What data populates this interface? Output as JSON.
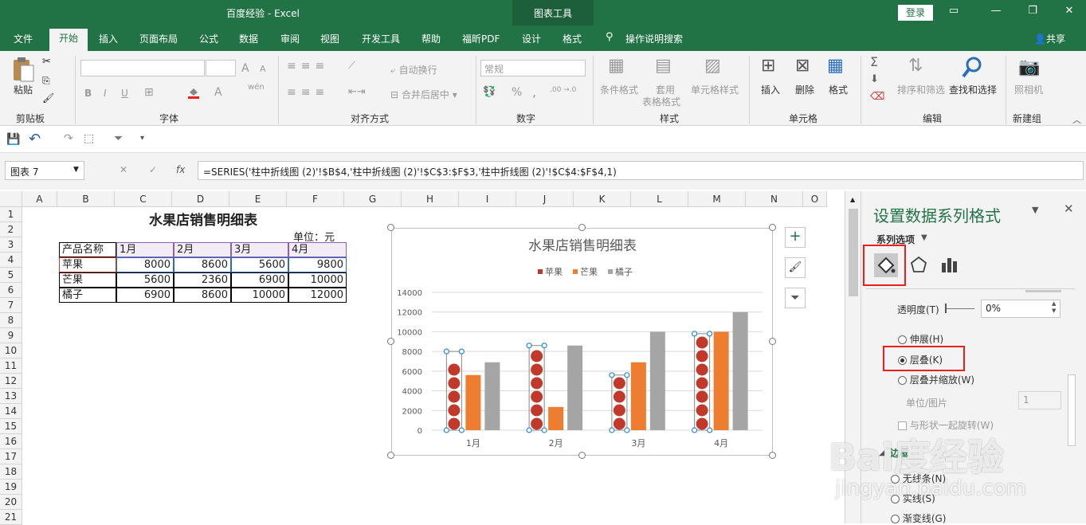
{
  "titlebar": {
    "title": "百度经验  -  Excel",
    "chart_tools": "图表工具",
    "login": "登录",
    "minimize": "—",
    "restore": "❐",
    "close": "✕"
  },
  "menu": {
    "tabs": [
      "文件",
      "开始",
      "插入",
      "页面布局",
      "公式",
      "数据",
      "审阅",
      "视图",
      "开发工具",
      "帮助",
      "福昕PDF",
      "设计",
      "格式"
    ],
    "search": "操作说明搜索",
    "share": "共享"
  },
  "ribbon": {
    "clipboard": {
      "paste": "粘贴",
      "label": "剪贴板"
    },
    "font": {
      "label": "字体",
      "bold": "B",
      "italic": "I",
      "underline": "U",
      "grow": "A",
      "shrink": "A",
      "wen": "wén"
    },
    "align": {
      "label": "对齐方式",
      "wrap": "自动换行",
      "merge": "合并后居中"
    },
    "number": {
      "label": "数字",
      "format": "常规",
      "percent": "%",
      "comma": ","
    },
    "styles": {
      "label": "样式",
      "cond": "条件格式",
      "table1": "套用",
      "table2": "表格格式",
      "cell": "单元格样式"
    },
    "cells": {
      "label": "单元格",
      "insert": "插入",
      "delete": "删除",
      "format": "格式"
    },
    "edit": {
      "label": "编辑",
      "sort": "排序和筛选",
      "find": "查找和选择"
    },
    "newgroup": {
      "label": "新建组",
      "camera": "照相机"
    }
  },
  "formula_bar": {
    "name_box": "图表 7",
    "fx": "fx",
    "cancel": "✕",
    "enter": "✓",
    "formula": "=SERIES('柱中折线图 (2)'!$B$4,'柱中折线图 (2)'!$C$3:$F$3,'柱中折线图 (2)'!$C$4:$F$4,1)"
  },
  "sheet": {
    "columns": [
      "A",
      "B",
      "C",
      "D",
      "E",
      "F",
      "G",
      "H",
      "I",
      "J",
      "K",
      "L",
      "M",
      "N",
      "O"
    ],
    "rows": [
      "1",
      "2",
      "3",
      "4",
      "5",
      "6",
      "7",
      "8",
      "9",
      "10",
      "11",
      "12",
      "13",
      "14",
      "15",
      "16",
      "17",
      "18",
      "19",
      "20",
      "21"
    ],
    "title": "水果店销售明细表",
    "unit": "单位：元",
    "header": [
      "产品名称",
      "1月",
      "2月",
      "3月",
      "4月"
    ],
    "data": [
      [
        "苹果",
        "8000",
        "8600",
        "5600",
        "9800"
      ],
      [
        "芒果",
        "5600",
        "2360",
        "6900",
        "10000"
      ],
      [
        "橘子",
        "6900",
        "8600",
        "10000",
        "12000"
      ]
    ]
  },
  "chart_data": {
    "type": "bar",
    "title": "水果店销售明细表",
    "categories": [
      "1月",
      "2月",
      "3月",
      "4月"
    ],
    "series": [
      {
        "name": "苹果",
        "values": [
          8000,
          8600,
          5600,
          9800
        ],
        "color": "#c0392b"
      },
      {
        "name": "芒果",
        "values": [
          5600,
          2360,
          6900,
          10000
        ],
        "color": "#ed7d31"
      },
      {
        "name": "橘子",
        "values": [
          6900,
          8600,
          10000,
          12000
        ],
        "color": "#a5a5a5"
      }
    ],
    "ylim": [
      0,
      14000
    ],
    "yticks": [
      "0",
      "2000",
      "4000",
      "6000",
      "8000",
      "10000",
      "12000",
      "14000"
    ],
    "legend": "top",
    "grid": true
  },
  "pane": {
    "title": "设置数据系列格式",
    "series_options": "系列选项",
    "transparency_label": "透明度(T)",
    "transparency_value": "0%",
    "stretch": "伸展(H)",
    "stack": "层叠(K)",
    "stack_scale": "层叠并缩放(W)",
    "units_label": "单位/图片",
    "units_value": "1",
    "rotate": "与形状一起旋转(W)",
    "border": "边框",
    "no_line": "无线条(N)",
    "solid_line": "实线(S)",
    "gradient_line": "渐变线(G)"
  },
  "watermark": {
    "brand": "Bai度经验",
    "url": "jingyan.baidu.com"
  }
}
